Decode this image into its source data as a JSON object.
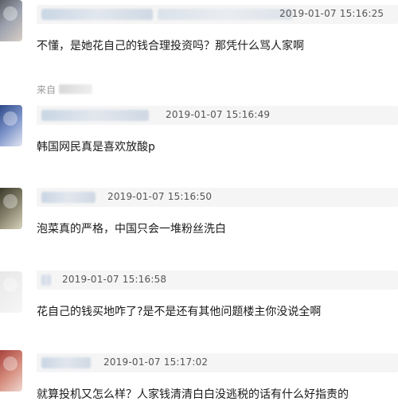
{
  "comments": [
    {
      "timestamp": "2019-01-07 15:16:25",
      "text": "不懂，是她花自己的钱合理投资吗？那凭什么骂人家啊",
      "source_prefix": "来自"
    },
    {
      "timestamp": "2019-01-07 15:16:49",
      "text": "韩国网民真是喜欢放酸p"
    },
    {
      "timestamp": "2019-01-07 15:16:50",
      "text": "泡菜真的严格，中国只会一堆粉丝洗白"
    },
    {
      "timestamp": "2019-01-07 15:16:58",
      "text": "花自己的钱买地咋了?是不是还有其他问题楼主你没说全啊"
    },
    {
      "timestamp": "2019-01-07 15:17:02",
      "text": "就算投机又怎么样？人家钱清清白白没逃税的话有什么好指责的"
    }
  ]
}
